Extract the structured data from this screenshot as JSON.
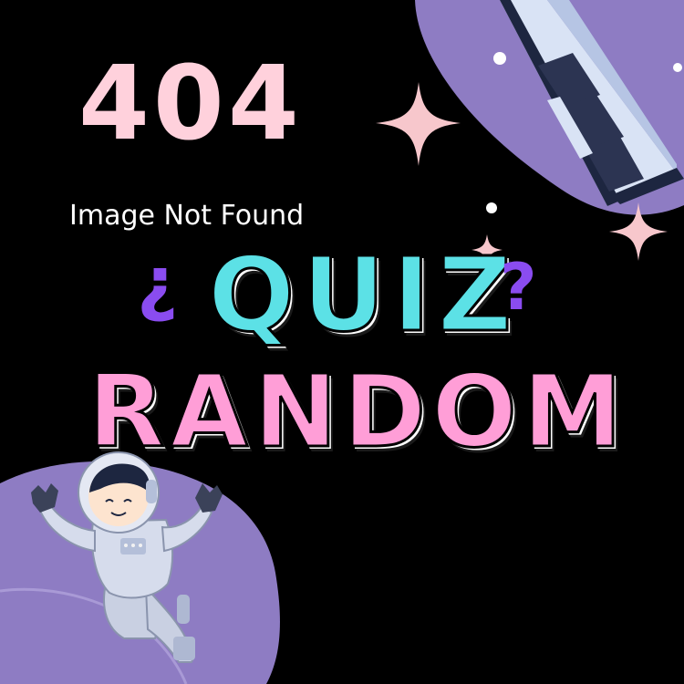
{
  "heading": {
    "code": "404",
    "message": "Image Not Found"
  },
  "title": {
    "question_open": "¿",
    "line1": "QUIZ",
    "question_close": "?",
    "line2": "RANDOM"
  },
  "colors": {
    "background": "#000000",
    "code": "#ffd1dc",
    "quiz": "#5ce1e6",
    "random": "#ff9ed7",
    "question_marks": "#8a4cf0",
    "planet": "#8e7cc3",
    "sparkle": "#f7c7cc"
  },
  "icons": [
    "rocket-icon",
    "astronaut-icon",
    "sparkle-icon",
    "planet-shape"
  ]
}
